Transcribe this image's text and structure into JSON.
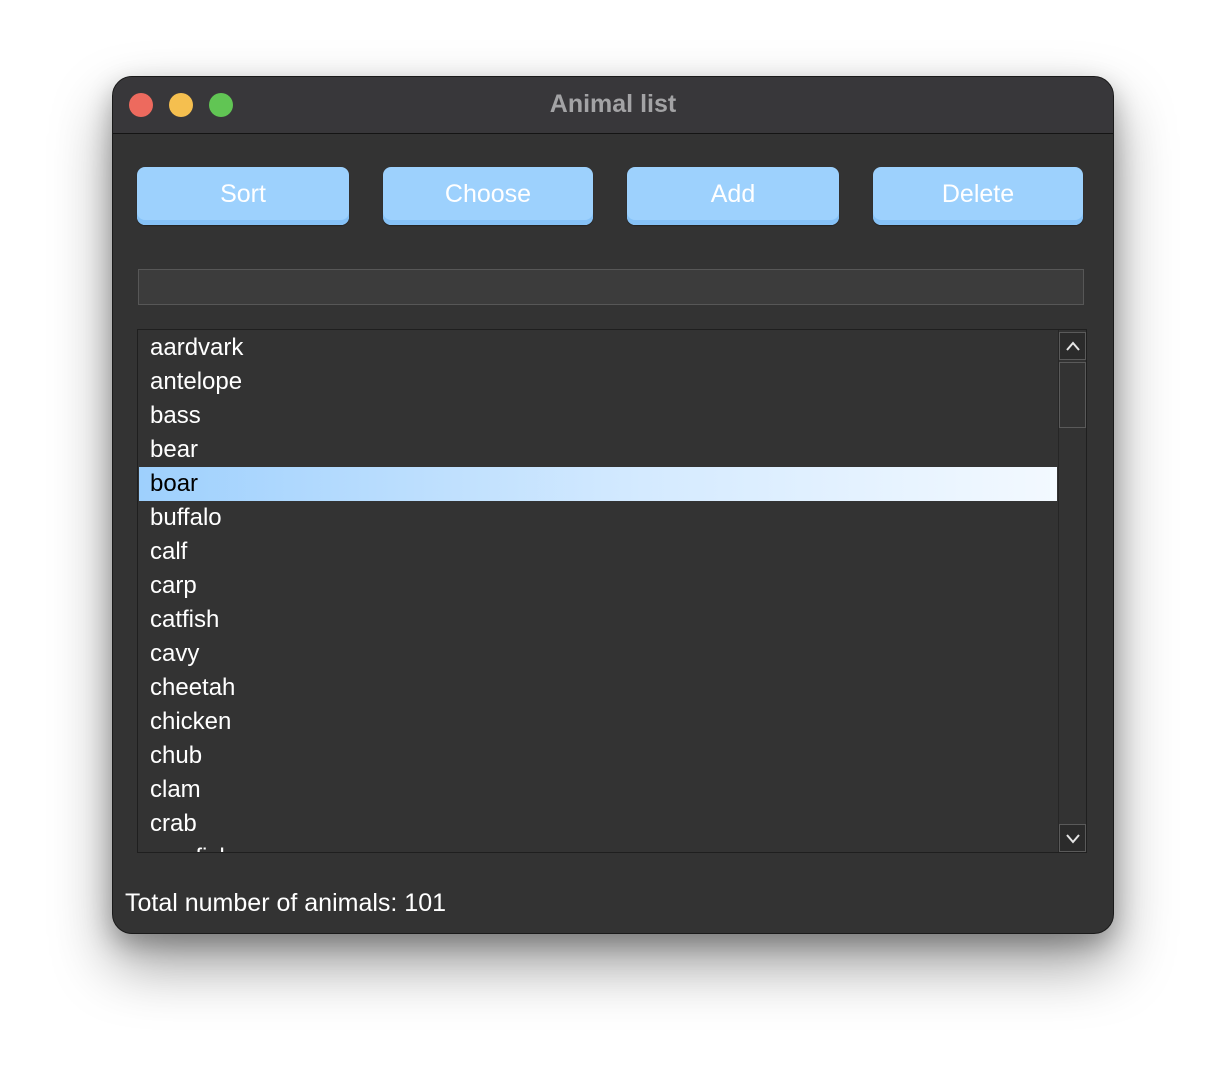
{
  "window": {
    "title": "Animal list"
  },
  "toolbar": {
    "sort_label": "Sort",
    "choose_label": "Choose",
    "add_label": "Add",
    "delete_label": "Delete"
  },
  "entry": {
    "value": ""
  },
  "list": {
    "items": [
      "aardvark",
      "antelope",
      "bass",
      "bear",
      "boar",
      "buffalo",
      "calf",
      "carp",
      "catfish",
      "cavy",
      "cheetah",
      "chicken",
      "chub",
      "clam",
      "crab",
      "crayfish"
    ],
    "selected": "boar"
  },
  "status": {
    "total_label": "Total number of animals: 101"
  },
  "colors": {
    "window_bg": "#333333",
    "button_bg": "#9dd1fd",
    "selection": "#9ed0fd",
    "close": "#ed6a5e",
    "minimize": "#f5bf4f",
    "maximize": "#61c554"
  }
}
